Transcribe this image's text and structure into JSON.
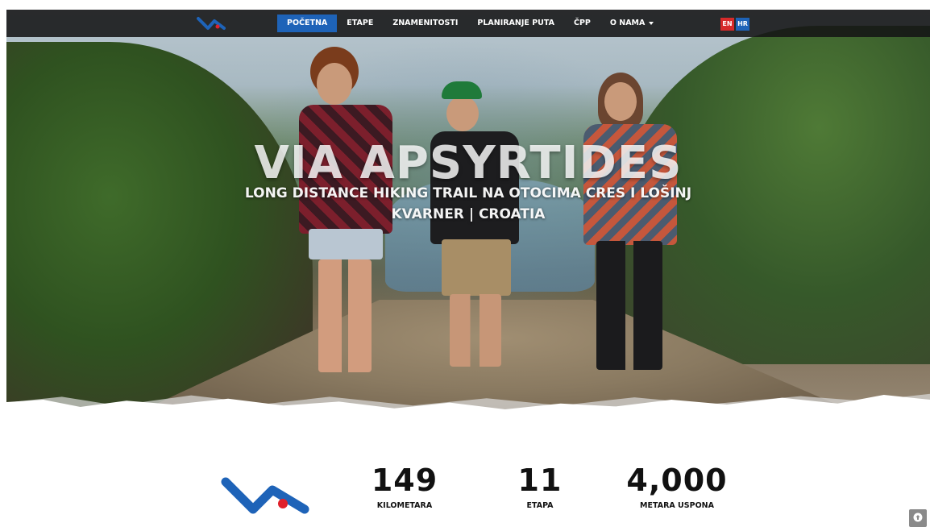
{
  "nav": {
    "items": [
      {
        "label": "POČETNA",
        "active": true
      },
      {
        "label": "ETAPE"
      },
      {
        "label": "ZNAMENITOSTI"
      },
      {
        "label": "PLANIRANJE PUTA"
      },
      {
        "label": "ČPP"
      },
      {
        "label": "O NAMA",
        "has_dropdown": true
      }
    ],
    "languages": [
      "EN",
      "HR"
    ],
    "active_language": "EN"
  },
  "hero": {
    "title": "VIA APSYRTIDES",
    "subtitle_line1": "LONG DISTANCE HIKING TRAIL NA OTOCIMA CRES I LOŠINJ",
    "subtitle_line2": "KVARNER | CROATIA"
  },
  "stats": [
    {
      "value": "149",
      "label": "KILOMETARA"
    },
    {
      "value": "11",
      "label": "ETAPA"
    },
    {
      "value": "4,000",
      "label": "METARA USPONA"
    }
  ],
  "colors": {
    "brand_blue": "#1e63b8",
    "brand_red": "#e0202a",
    "nav_bg": "#141416",
    "lang_en": "#d62a2a"
  },
  "icons": {
    "logo": "va-logo",
    "scroll_top": "arrow-up-circle-icon",
    "dropdown": "caret-down-icon"
  }
}
